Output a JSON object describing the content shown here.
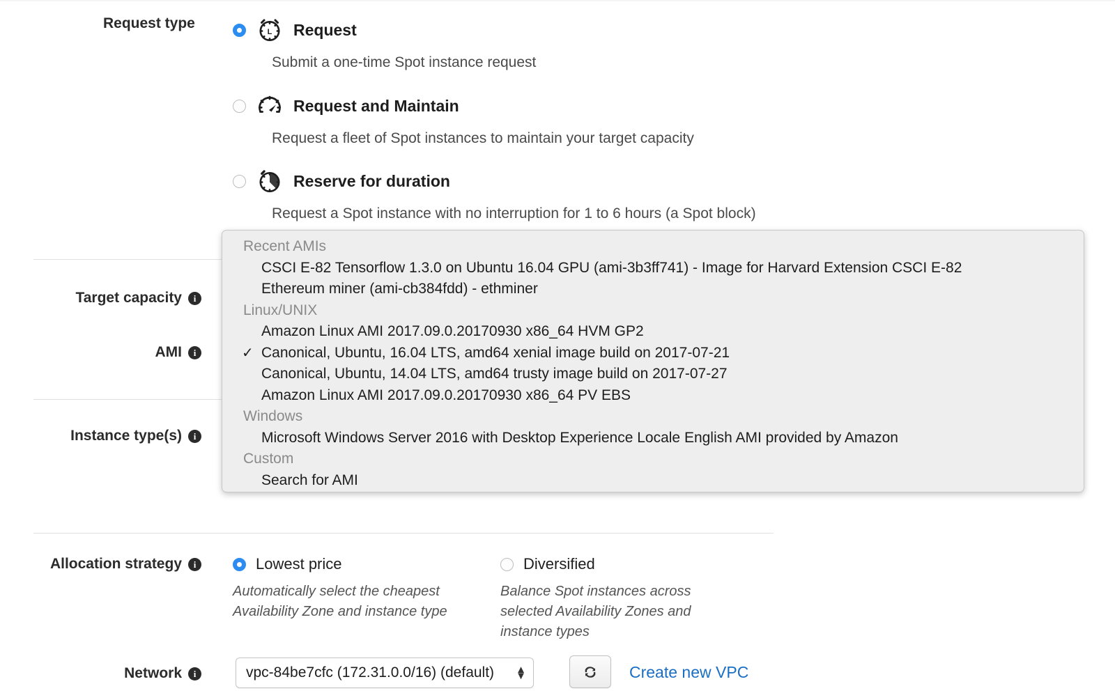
{
  "request_type": {
    "label": "Request type",
    "info_icon": "info-icon",
    "options": [
      {
        "id": "request",
        "icon": "alarm-clock-icon",
        "title": "Request",
        "description": "Submit a one-time Spot instance request",
        "selected": true
      },
      {
        "id": "request-and-maintain",
        "icon": "gauge-icon",
        "title": "Request and Maintain",
        "description": "Request a fleet of Spot instances to maintain your target capacity",
        "selected": false
      },
      {
        "id": "reserve-for-duration",
        "icon": "stopwatch-icon",
        "title": "Reserve for duration",
        "description": "Request a Spot instance with no interruption for 1 to 6 hours (a Spot block)",
        "selected": false
      }
    ]
  },
  "target_capacity": {
    "label": "Target capacity",
    "info_icon": "info-icon"
  },
  "ami": {
    "label": "AMI",
    "info_icon": "info-icon"
  },
  "instance_types": {
    "label": "Instance type(s)",
    "info_icon": "info-icon"
  },
  "ami_dropdown": {
    "groups": [
      {
        "label": "Recent AMIs",
        "items": [
          {
            "text": "CSCI E-82 Tensorflow 1.3.0 on Ubuntu 16.04 GPU (ami-3b3ff741) - Image for Harvard Extension CSCI E-82",
            "checked": false
          },
          {
            "text": "Ethereum miner (ami-cb384fdd) - ethminer",
            "checked": false
          }
        ]
      },
      {
        "label": "Linux/UNIX",
        "items": [
          {
            "text": "Amazon Linux AMI 2017.09.0.20170930 x86_64 HVM GP2",
            "checked": false
          },
          {
            "text": "Canonical, Ubuntu, 16.04 LTS, amd64 xenial image build on 2017-07-21",
            "checked": true
          },
          {
            "text": "Canonical, Ubuntu, 14.04 LTS, amd64 trusty image build on 2017-07-27",
            "checked": false
          },
          {
            "text": "Amazon Linux AMI 2017.09.0.20170930 x86_64 PV EBS",
            "checked": false
          }
        ]
      },
      {
        "label": "Windows",
        "items": [
          {
            "text": "Microsoft Windows Server 2016 with Desktop Experience Locale English AMI provided by Amazon",
            "checked": false
          }
        ]
      },
      {
        "label": "Custom",
        "items": [
          {
            "text": "Search for AMI",
            "checked": false
          }
        ]
      }
    ],
    "check_glyph": "✓"
  },
  "allocation_strategy": {
    "label": "Allocation strategy",
    "info_icon": "info-icon",
    "options": [
      {
        "id": "lowest-price",
        "label": "Lowest price",
        "description": "Automatically select the cheapest Availability Zone and instance type",
        "selected": true
      },
      {
        "id": "diversified",
        "label": "Diversified",
        "description": "Balance Spot instances across selected Availability Zones and instance types",
        "selected": false
      }
    ]
  },
  "network": {
    "label": "Network",
    "info_icon": "info-icon",
    "selected_value": "vpc-84be7cfc (172.31.0.0/16) (default)",
    "refresh_icon": "refresh-icon",
    "create_link": "Create new VPC"
  },
  "colors": {
    "accent_blue": "#2d8cf0",
    "link_blue": "#1a6fc4",
    "dropdown_bg": "#eeeeee",
    "text": "#1d1d1d",
    "muted": "#8a8a8a"
  }
}
